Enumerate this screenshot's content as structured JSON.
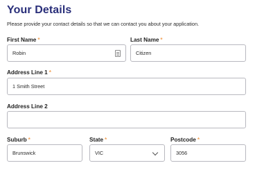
{
  "header": {
    "title": "Your Details",
    "intro": "Please provide your contact details so that we can contact you about your application."
  },
  "form": {
    "required_marker": "*",
    "first_name": {
      "label": "First Name",
      "value": "Robin"
    },
    "last_name": {
      "label": "Last Name",
      "value": "Citizen"
    },
    "address_line_1": {
      "label": "Address Line 1",
      "value": "1 Smith Street"
    },
    "address_line_2": {
      "label": "Address Line 2",
      "value": ""
    },
    "suburb": {
      "label": "Suburb",
      "value": "Brunswick"
    },
    "state": {
      "label": "State",
      "value": "VIC"
    },
    "postcode": {
      "label": "Postcode",
      "value": "3056"
    }
  },
  "colors": {
    "title": "#2a2f7a",
    "required_marker": "#f2a35a",
    "field_border": "#b8b8bf"
  },
  "icons": {
    "first_name_field": "contact-card-icon",
    "state_select": "chevron-down-icon"
  }
}
